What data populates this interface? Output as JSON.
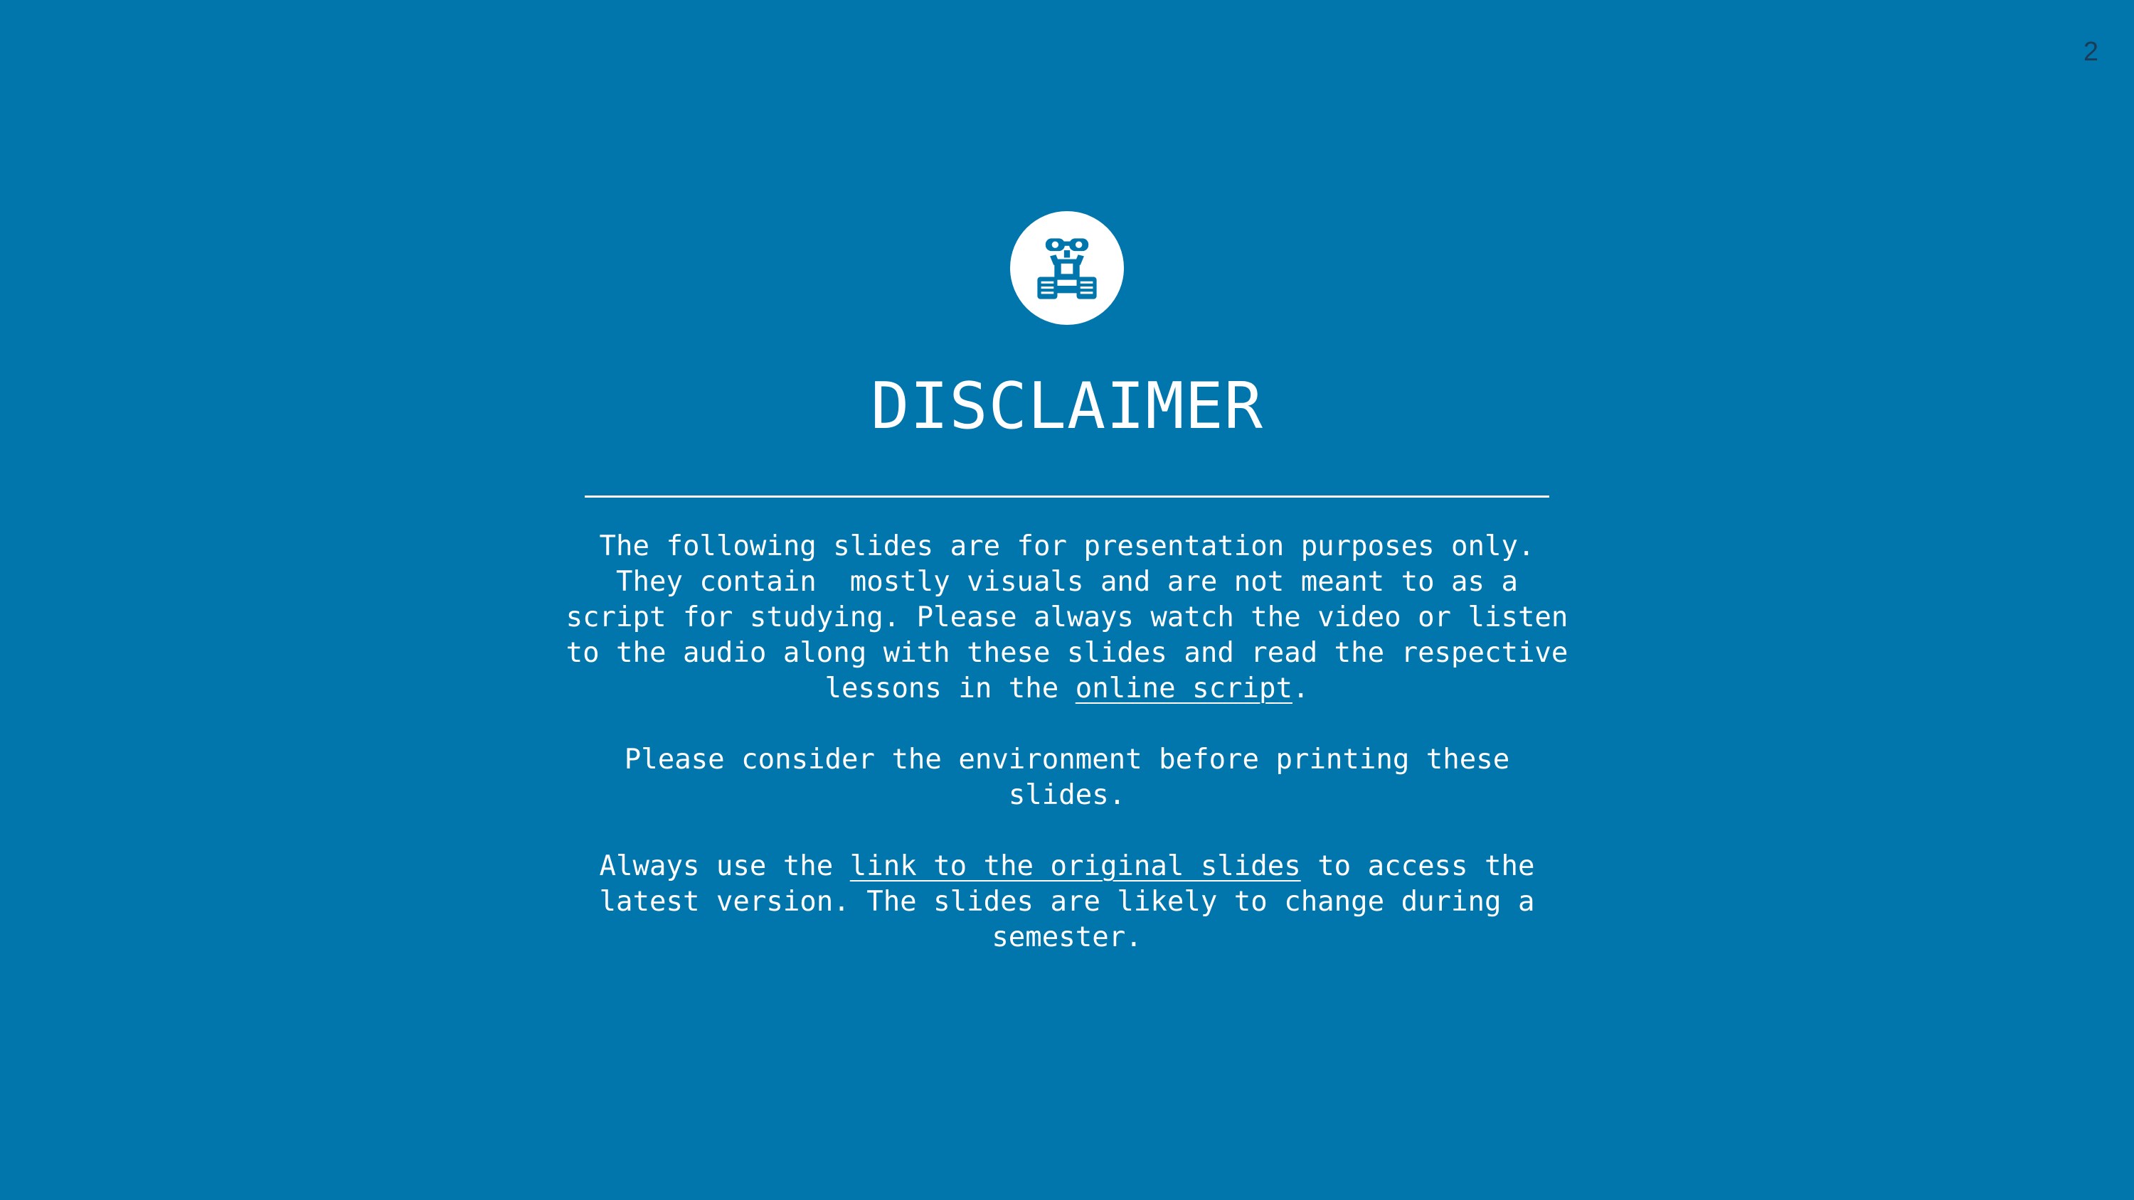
{
  "slide": {
    "page_number": "2",
    "background_color": "#0076ad",
    "logo_icon": "robot-icon",
    "title": "DISCLAIMER"
  },
  "paragraphs": {
    "p1": {
      "line1": "The following slides are for presentation purposes only.",
      "line2": "They contain  mostly visuals and are not meant to as a",
      "line3": "script for studying. Please always watch the video or listen",
      "line4": "to the audio along with these slides and read the respective",
      "line5_before": "lessons in the ",
      "link_text": "online script",
      "line5_after": "."
    },
    "p2": {
      "line1": "Please consider the environment before printing these",
      "line2": "slides."
    },
    "p3": {
      "line1_before": "Always use the ",
      "link_text": "link to the original slides",
      "line1_after": " to access the",
      "line2": "latest version. The slides are likely to change during a",
      "line3": "semester."
    }
  }
}
